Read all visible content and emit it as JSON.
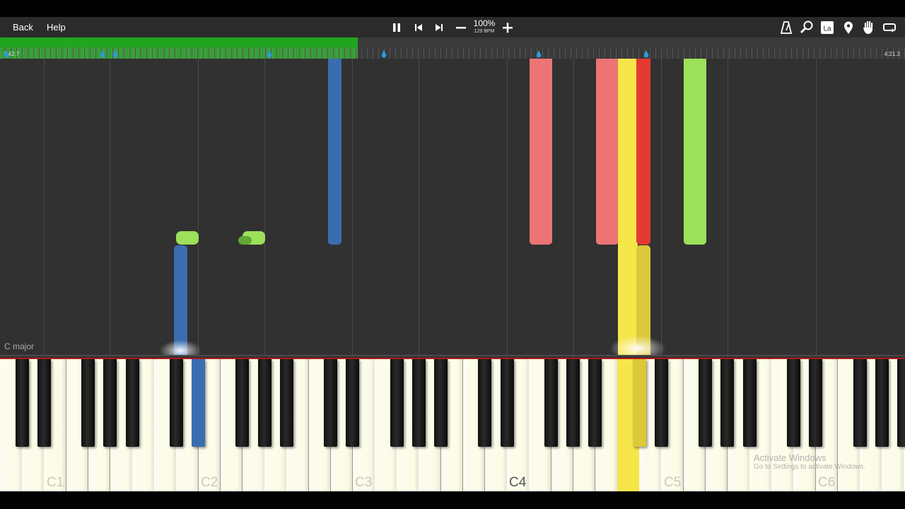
{
  "toolbar": {
    "back_label": "Back",
    "help_label": "Help",
    "speed_percent": "100%",
    "tempo": "129 BPM",
    "icons": [
      "pause-icon",
      "previous-icon",
      "next-icon",
      "minus-icon",
      "plus-icon",
      "metronome-icon",
      "zoom-icon",
      "label-icon",
      "marker-icon",
      "hand-icon",
      "loop-icon"
    ]
  },
  "progress": {
    "position": 0.395,
    "time_start": "1:42.7",
    "time_end": "4:21.3"
  },
  "roll": {
    "key_signature": "C major"
  },
  "keyboard": {
    "octave_labels": [
      "C1",
      "C2",
      "C3",
      "C4",
      "C5",
      "C6"
    ]
  },
  "colors": {
    "progress_green": "#1fa51f",
    "marker_blue": "#2a9be0",
    "note_blue": "#3a6db0",
    "note_green": "#9de05a",
    "note_pink": "#ec7474",
    "note_red": "#e53a32",
    "note_yellow": "#f5e64a"
  },
  "watermark": {
    "title": "Activate Windows",
    "subtitle": "Go to Settings to activate Windows."
  }
}
